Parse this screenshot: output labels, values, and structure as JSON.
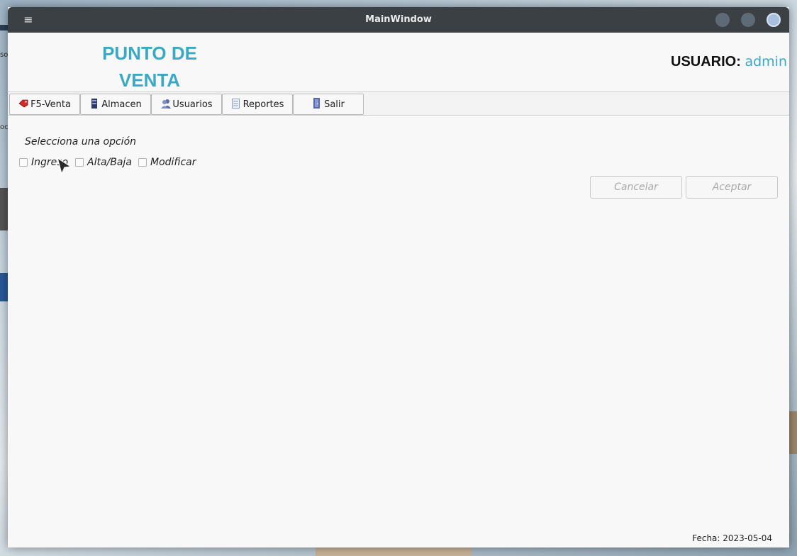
{
  "window": {
    "title": "MainWindow",
    "menu_icon": "hamburger-menu-icon"
  },
  "header": {
    "brand_line1": "PUNTO DE",
    "brand_line2": "VENTA",
    "user_label": "USUARIO:",
    "user_name": "admin"
  },
  "tabs": [
    {
      "label": "F5-Venta",
      "icon": "tag-icon"
    },
    {
      "label": "Almacen",
      "icon": "warehouse-icon"
    },
    {
      "label": "Usuarios",
      "icon": "users-icon"
    },
    {
      "label": "Reportes",
      "icon": "document-icon"
    },
    {
      "label": "Salir",
      "icon": "exit-door-icon"
    }
  ],
  "panel": {
    "prompt": "Selecciona una opción",
    "options": [
      {
        "label": "Ingreso",
        "checked": false
      },
      {
        "label": "Alta/Baja",
        "checked": false
      },
      {
        "label": "Modificar",
        "checked": false
      }
    ],
    "cancel_label": "Cancelar",
    "accept_label": "Aceptar"
  },
  "footer": {
    "fecha": "Fecha: 2023-05-04"
  },
  "colors": {
    "accent": "#3ba8c4",
    "titlebar": "#3b4045",
    "disabled_text": "#a9a9a9"
  }
}
